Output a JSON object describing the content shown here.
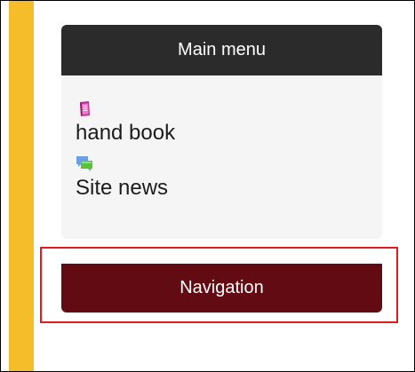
{
  "colors": {
    "accent_strip": "#f6bd2b",
    "block_header_bg": "#2b2b2b",
    "navigation_bg": "#620b12",
    "highlight_border": "#e01b1b"
  },
  "main_menu": {
    "title": "Main menu",
    "items": [
      {
        "label": "hand book",
        "icon": "book-icon"
      },
      {
        "label": "Site news",
        "icon": "forum-icon"
      }
    ]
  },
  "navigation": {
    "title": "Navigation"
  }
}
